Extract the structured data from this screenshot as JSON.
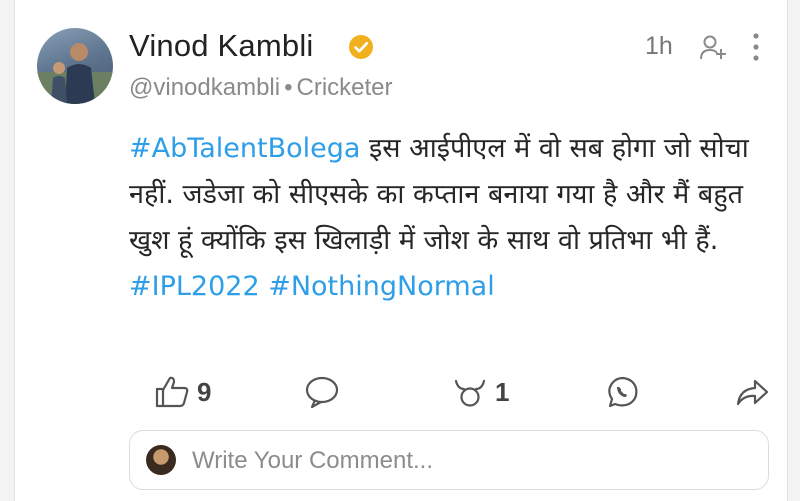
{
  "post": {
    "author_name": "Vinod Kambli",
    "author_handle": "@vinodkambli",
    "separator": "•",
    "author_role": "Cricketer",
    "time_ago": "1h",
    "hashtag_1": "#AbTalentBolega",
    "body_text": " इस आईपीएल में वो सब होगा जो सोचा नहीं. जडेजा को सीएसके का कप्तान बनाया गया है और मैं बहुत खुश हूं क्योंकि इस खिलाड़ी में जोश के साथ वो प्रतिभा भी हैं. ",
    "hashtag_2": "#IPL2022",
    "hashtag_3": "#NothingNormal"
  },
  "actions": {
    "like_count": "9",
    "reaction_count": "1"
  },
  "comment": {
    "placeholder": "Write Your Comment..."
  },
  "icons": {
    "verified": "verified-badge-icon",
    "follow": "add-user-icon",
    "more": "more-vertical-icon",
    "like": "thumbs-up-icon",
    "comment": "comment-bubble-icon",
    "reaction": "bull-reaction-icon",
    "whatsapp": "whatsapp-icon",
    "share": "share-arrow-icon"
  },
  "colors": {
    "hashtag": "#2e9ee8",
    "verified": "#f2b01e"
  }
}
